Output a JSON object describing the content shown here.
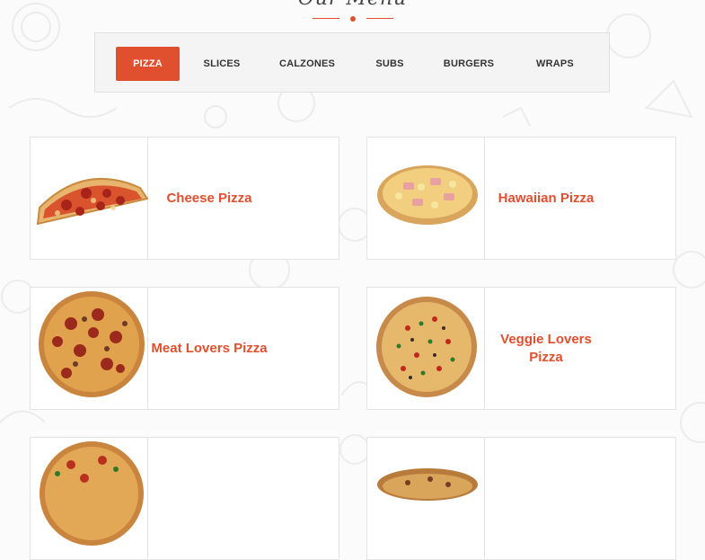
{
  "section": {
    "heading": "Our Menu"
  },
  "tabs": [
    {
      "label": "PIZZA",
      "active": true
    },
    {
      "label": "SLICES",
      "active": false
    },
    {
      "label": "CALZONES",
      "active": false
    },
    {
      "label": "SUBS",
      "active": false
    },
    {
      "label": "BURGERS",
      "active": false
    },
    {
      "label": "WRAPS",
      "active": false
    }
  ],
  "menu_items": [
    {
      "name": "Cheese Pizza",
      "image": "pizza-slice-image"
    },
    {
      "name": "Hawaiian Pizza",
      "image": "hawaiian-pizza-image"
    },
    {
      "name": "Meat Lovers Pizza",
      "image": "meat-lovers-pizza-image"
    },
    {
      "name": "Veggie Lovers Pizza",
      "image": "veggie-pizza-image"
    },
    {
      "name": "",
      "image": "supreme-pizza-image"
    },
    {
      "name": "",
      "image": "pizza-image"
    }
  ],
  "colors": {
    "accent": "#e0502f",
    "tab_bar_bg": "#f4f4f4",
    "card_border": "#e3e3e3"
  }
}
